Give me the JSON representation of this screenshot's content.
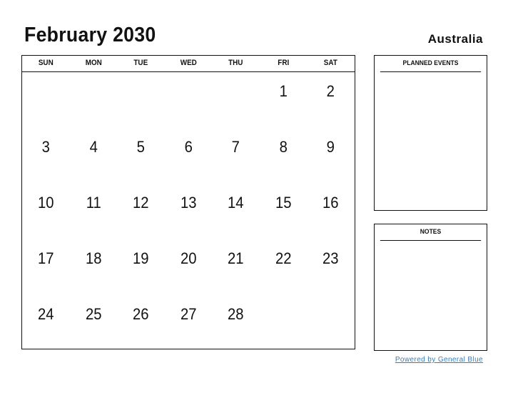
{
  "header": {
    "title": "February 2030",
    "country": "Australia"
  },
  "calendar": {
    "weekdays": [
      "SUN",
      "MON",
      "TUE",
      "WED",
      "THU",
      "FRI",
      "SAT"
    ],
    "days": [
      "",
      "",
      "",
      "",
      "",
      "1",
      "2",
      "3",
      "4",
      "5",
      "6",
      "7",
      "8",
      "9",
      "10",
      "11",
      "12",
      "13",
      "14",
      "15",
      "16",
      "17",
      "18",
      "19",
      "20",
      "21",
      "22",
      "23",
      "24",
      "25",
      "26",
      "27",
      "28",
      "",
      "",
      "",
      "",
      "",
      "",
      ""
    ]
  },
  "planned_events": {
    "label": "PLANNED EVENTS"
  },
  "notes": {
    "label": "NOTES"
  },
  "footer": {
    "powered_by": "Powered by General Blue",
    "link_color": "#2f7fc8"
  }
}
